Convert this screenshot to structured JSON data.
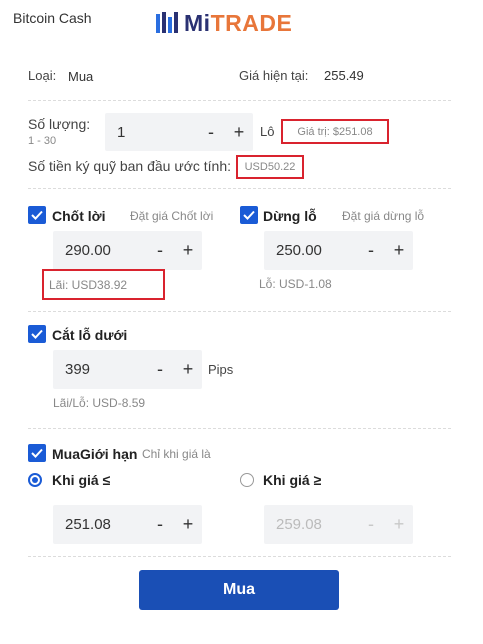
{
  "header": {
    "title": "Bitcoin Cash",
    "logo_text_a": "Mi",
    "logo_text_b": "TRADE"
  },
  "order": {
    "type_label": "Loại:",
    "type_value": "Mua",
    "price_label": "Giá hiện tại:",
    "price_value": "255.49"
  },
  "quantity": {
    "label": "Số lượng:",
    "range": "1 - 30",
    "value": "1",
    "unit": "Lô",
    "value_info": "Giá trị:  $251.08"
  },
  "margin": {
    "label": "Số tiền ký quỹ ban đầu ước tính:",
    "value": "USD50.22"
  },
  "take_profit": {
    "label": "Chốt lời",
    "hint": "Đặt giá Chốt lời",
    "value": "290.00",
    "result": "Lãi:  USD38.92"
  },
  "stop_loss": {
    "label": "Dừng lỗ",
    "hint": "Đặt giá dừng lỗ",
    "value": "250.00",
    "result": "Lỗ:  USD-1.08"
  },
  "trailing": {
    "label": "Cắt lỗ dưới",
    "value": "399",
    "unit": "Pips",
    "result": "Lãi/Lỗ:  USD-8.59"
  },
  "limit": {
    "label": "MuaGiới hạn",
    "hint": "Chỉ khi giá là",
    "option_a": "Khi giá ≤",
    "option_b": "Khi giá ≥",
    "value_a": "251.08",
    "value_b": "259.08"
  },
  "controls": {
    "minus": "-",
    "plus": "+"
  },
  "submit_label": "Mua",
  "colors": {
    "accent": "#1a5bd6",
    "button": "#1a4fb5",
    "highlight": "#d9232e",
    "logo_dark": "#2a3172",
    "logo_orange": "#e8763a"
  }
}
